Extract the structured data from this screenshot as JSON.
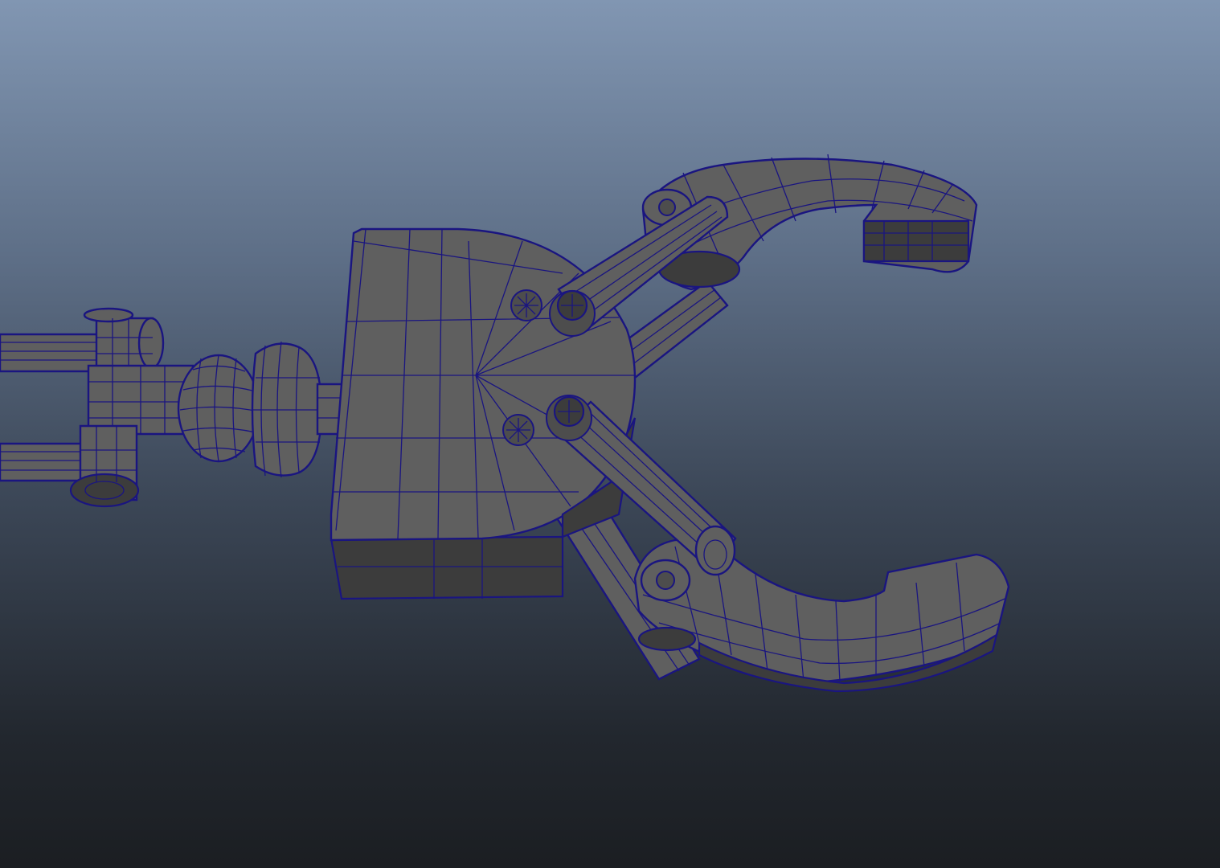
{
  "viewport": {
    "background_top": "#8196b2",
    "background_bottom": "#1b1e22",
    "mesh_fill": "#5f5f5f",
    "wire_color": "#1a1580"
  },
  "model": {
    "parts": [
      "arm-rods",
      "hinge-joint",
      "ball-neck",
      "gripper-base",
      "upper-claw",
      "lower-claw",
      "linkage-bars",
      "pivot-bolts"
    ]
  }
}
